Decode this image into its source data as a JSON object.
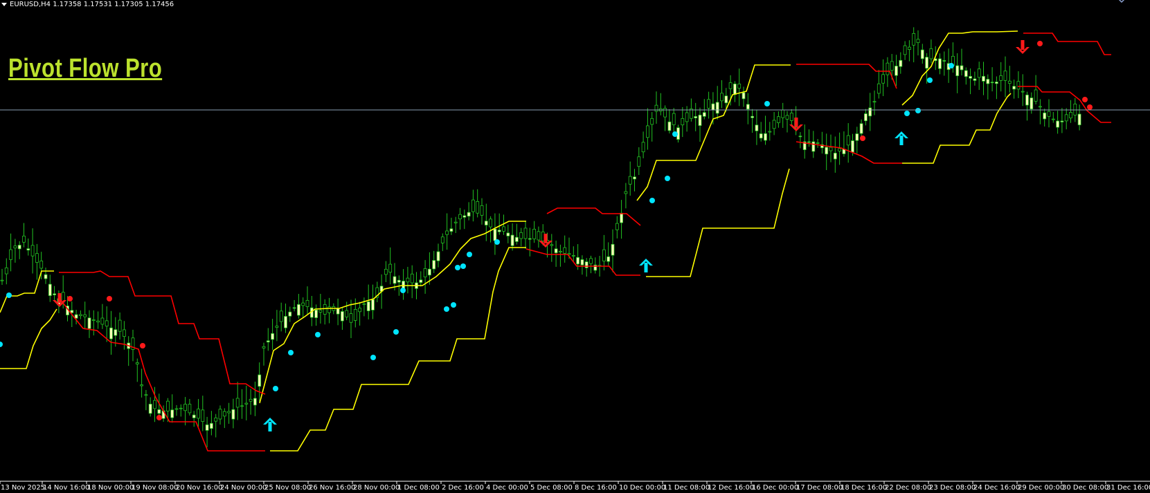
{
  "header": {
    "symbol_info": "EURUSD,H4  1.17358 1.17531 1.17305 1.17456"
  },
  "brand": {
    "title": "Pivot Flow Pro"
  },
  "colors": {
    "background": "#000000",
    "candle_up": "#ffffb8",
    "candle_wick": "#22c422",
    "support_line": "#ffff00",
    "resistance_line": "#ff0000",
    "buy_arrow": "#00e5ff",
    "sell_arrow": "#ff1a1a",
    "buy_dot": "#00e5ff",
    "sell_dot": "#ff1a1a",
    "price_line": "#8aa0b4",
    "brand": "#bce22d"
  },
  "chart_data": {
    "type": "candlestick",
    "symbol": "EURUSD",
    "timeframe": "H4",
    "x_ticks": [
      "13 Nov 2025",
      "14 Nov 16:00",
      "18 Nov 00:00",
      "19 Nov 08:00",
      "20 Nov 16:00",
      "24 Nov 00:00",
      "25 Nov 08:00",
      "26 Nov 16:00",
      "28 Nov 00:00",
      "1 Dec 08:00",
      "2 Dec 16:00",
      "4 Dec 00:00",
      "5 Dec 08:00",
      "8 Dec 16:00",
      "10 Dec 00:00",
      "11 Dec 08:00",
      "12 Dec 16:00",
      "16 Dec 00:00",
      "17 Dec 08:00",
      "18 Dec 16:00",
      "22 Dec 08:00",
      "23 Dec 08:00",
      "24 Dec 16:00",
      "29 Dec 00:00",
      "30 Dec 08:00",
      "31 Dec 16:00"
    ],
    "buy_arrows": [
      "25 Nov 08:00",
      "10 Dec 00:00",
      "22 Dec 08:00"
    ],
    "sell_arrows": [
      "14 Nov 16:00",
      "5 Dec 08:00",
      "16 Dec 00:00",
      "29 Dec 00:00"
    ],
    "grid": false
  }
}
